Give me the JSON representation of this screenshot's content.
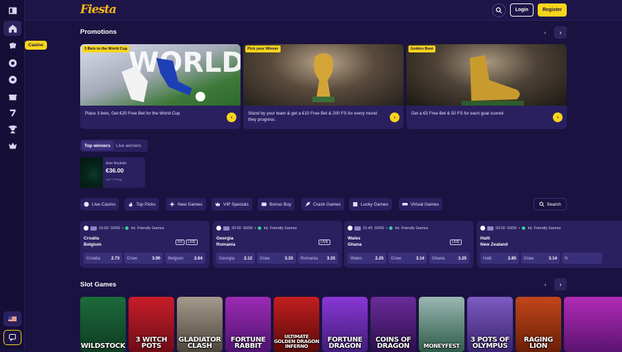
{
  "header": {
    "logo": "Fiesta",
    "login": "Login",
    "register": "Register"
  },
  "sidebar": {
    "tooltip": "Casino"
  },
  "promotions": {
    "title": "Promotions",
    "items": [
      {
        "tag": "3 Bets to the World Cup",
        "text": "Place 3 bets, Get €20 Free Bet for the World Cup"
      },
      {
        "tag": "Pick your Winner",
        "text": "Stand by your team & get a €10 Free Bet & 200 FS for every round they progress."
      },
      {
        "tag": "Golden Boot",
        "text": "Get a €5 Free Bet & 50 FS for each goal scored"
      }
    ]
  },
  "winners": {
    "tabs": [
      "Top winners",
      "Live winners"
    ],
    "item": {
      "game": "Auto Roulette",
      "amount": "€36.00",
      "user": "Tv** *****nd"
    }
  },
  "categories": [
    "Live Casino",
    "Top Picks",
    "New Games",
    "VIP Specials",
    "Bonus Buy",
    "Crash Games",
    "Lucky Games",
    "Virtual Games"
  ],
  "search_label": "Search",
  "matches": [
    {
      "time": "19:00",
      "date": "02/06",
      "league": "Int. Friendly Games",
      "team1": "Croatia",
      "team2": "Belgium",
      "badge1": "0:0",
      "badge2": "LIVE",
      "odds": [
        {
          "label": "Croatia",
          "value": "2.73"
        },
        {
          "label": "Draw",
          "value": "3.90"
        },
        {
          "label": "Belgium",
          "value": "2.64"
        }
      ]
    },
    {
      "time": "20:00",
      "date": "02/06",
      "league": "Int. Friendly Games",
      "team1": "Georgia",
      "team2": "Romania",
      "badge1": "",
      "badge2": "LIVE",
      "odds": [
        {
          "label": "Georgia",
          "value": "2.12"
        },
        {
          "label": "Draw",
          "value": "3.33"
        },
        {
          "label": "Romania",
          "value": "3.33"
        }
      ]
    },
    {
      "time": "21:45",
      "date": "02/06",
      "league": "Int. Friendly Games",
      "team1": "Wales",
      "team2": "Ghana",
      "badge1": "",
      "badge2": "LIVE",
      "odds": [
        {
          "label": "Wales",
          "value": "2.25"
        },
        {
          "label": "Draw",
          "value": "3.14"
        },
        {
          "label": "Ghana",
          "value": "3.25"
        }
      ]
    },
    {
      "time": "03:00",
      "date": "03/06",
      "league": "Int. Friendly Games",
      "team1": "Haiti",
      "team2": "New Zealand",
      "badge1": "",
      "badge2": "",
      "odds": [
        {
          "label": "Haiti",
          "value": "2.85"
        },
        {
          "label": "Draw",
          "value": "3.14"
        },
        {
          "label": "N",
          "value": ""
        }
      ]
    }
  ],
  "slots": {
    "title": "Slot Games",
    "games": [
      {
        "name": "WILDSTOCK"
      },
      {
        "name": "3 WITCH POTS"
      },
      {
        "name": "GLADIATOR CLASH"
      },
      {
        "name": "FORTUNE RABBIT"
      },
      {
        "name": "ULTIMATE GOLDEN DRAGON INFERNO"
      },
      {
        "name": "FORTUNE DRAGON"
      },
      {
        "name": "COINS OF DRAGON"
      },
      {
        "name": "MONEYFEST"
      },
      {
        "name": "3 POTS OF OLYMPUS"
      },
      {
        "name": "RAGING LION"
      }
    ]
  }
}
